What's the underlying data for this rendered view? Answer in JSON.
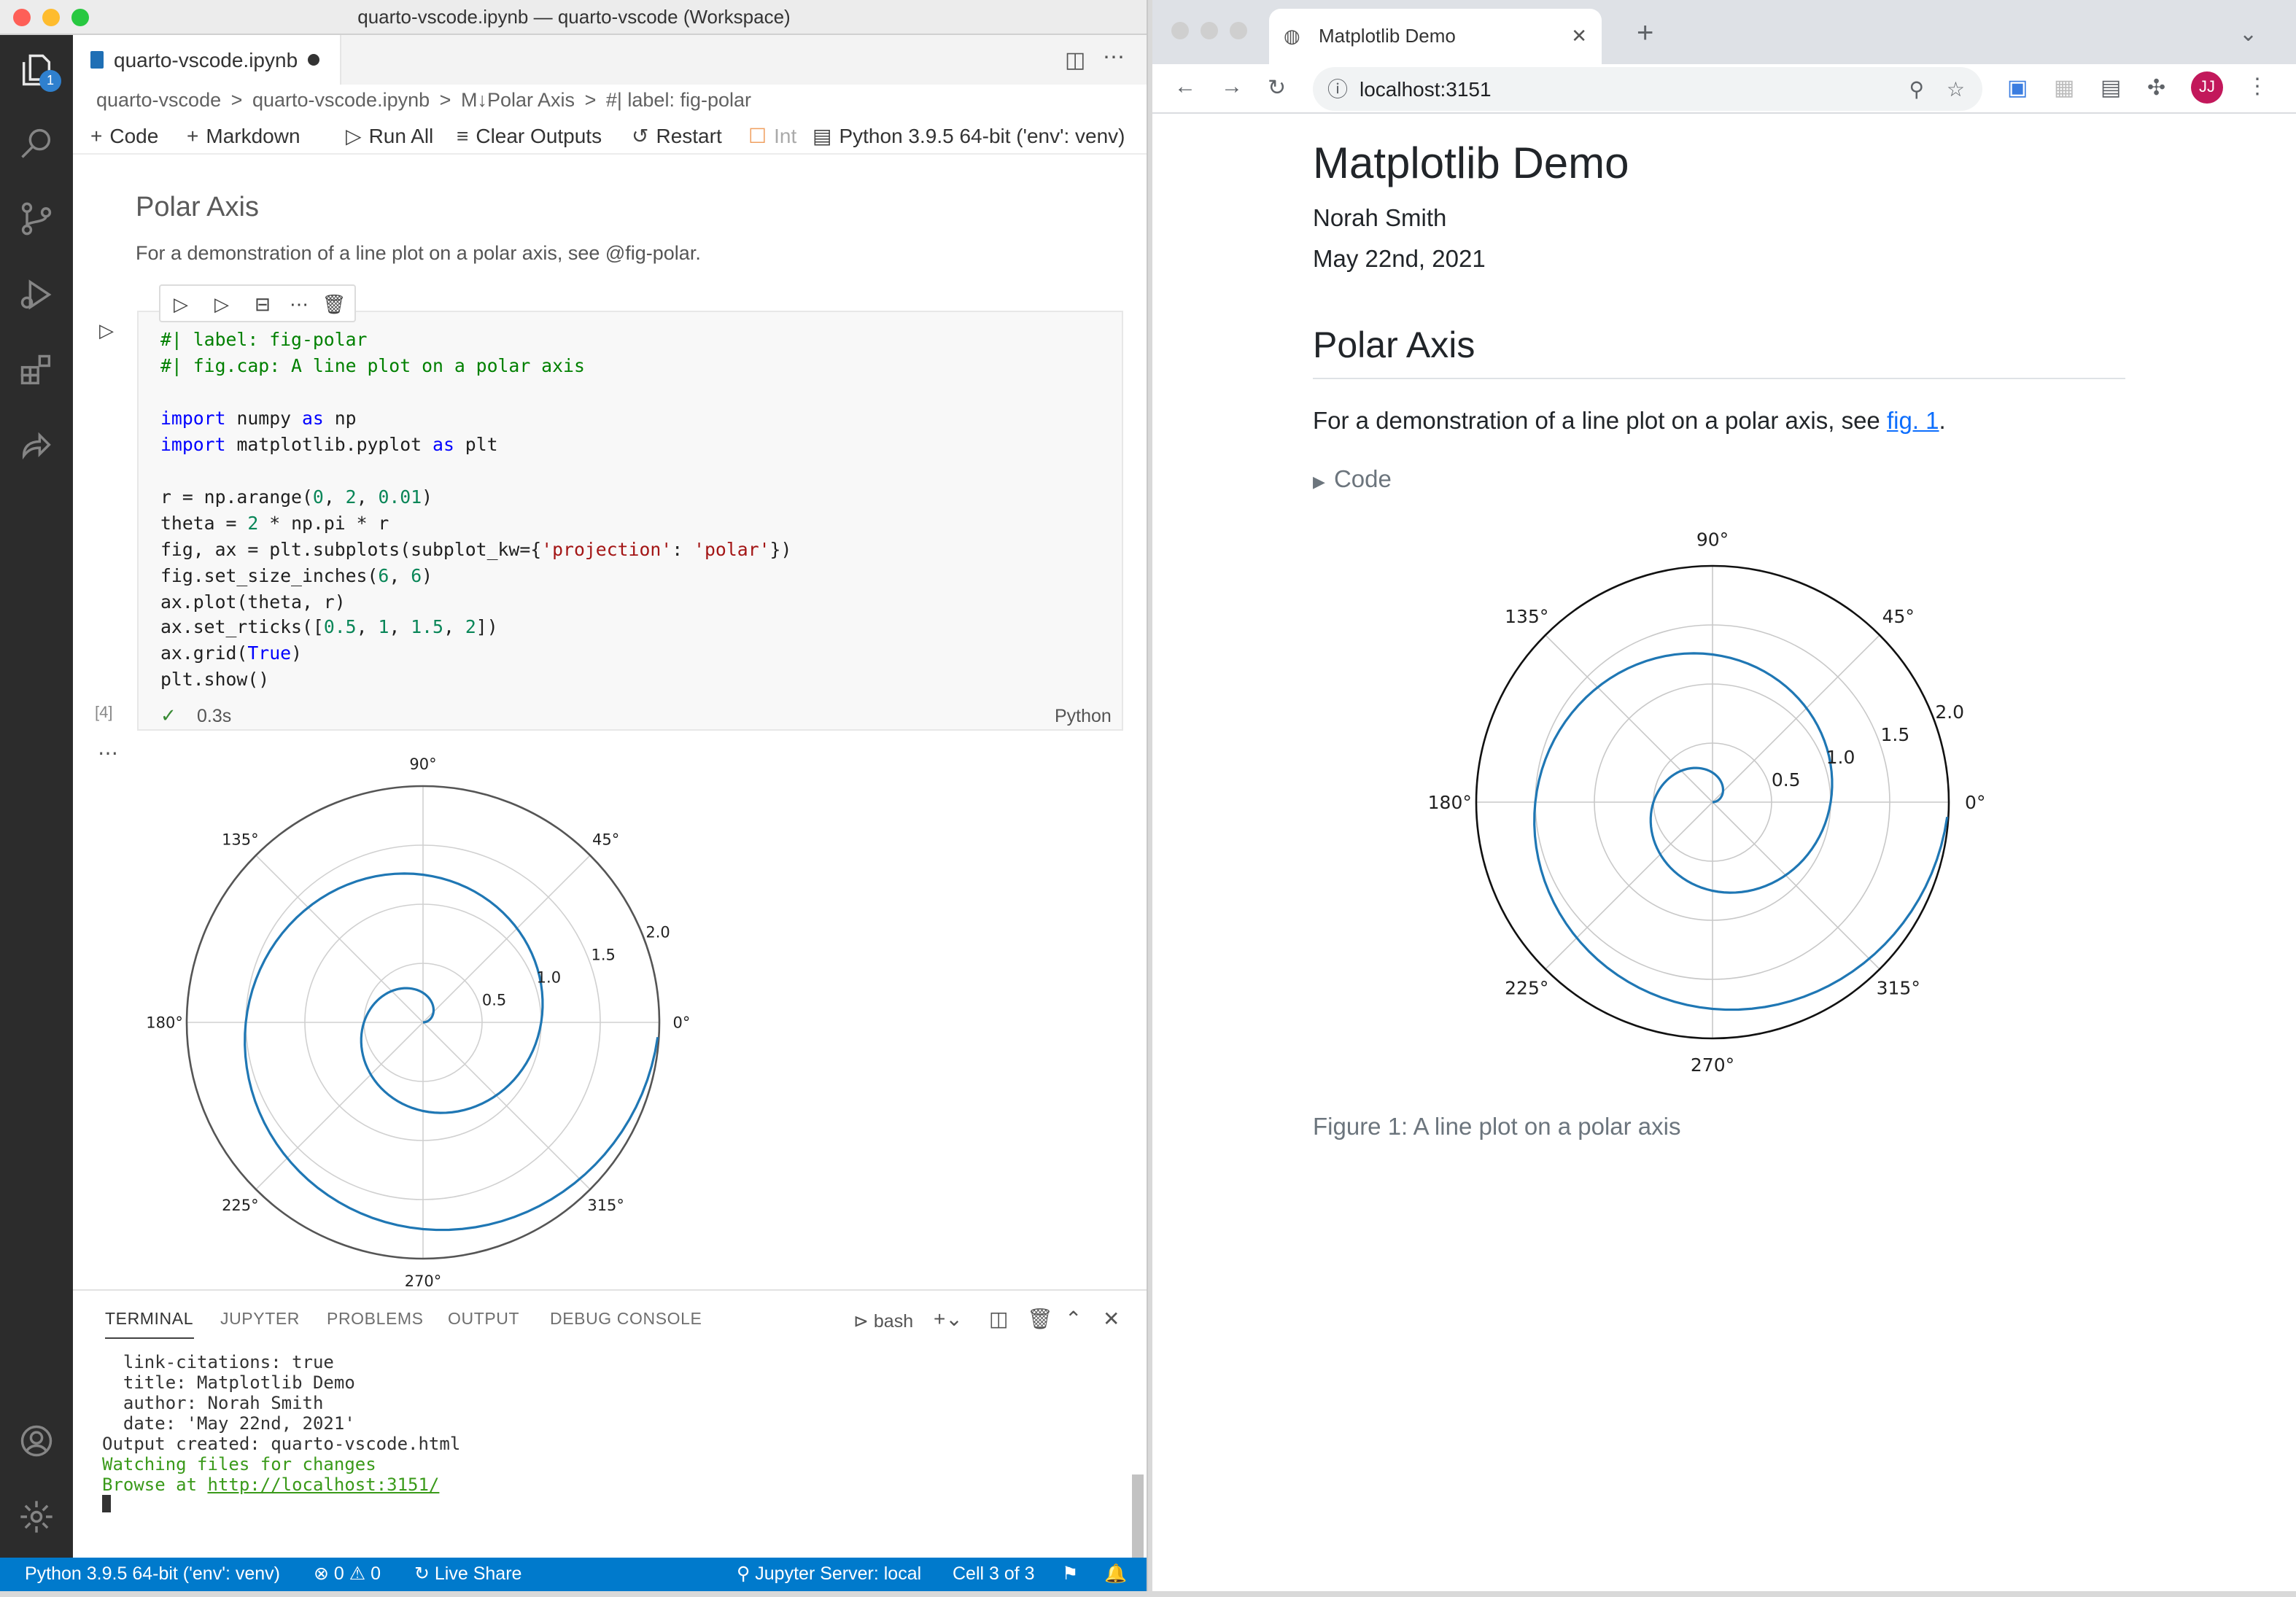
{
  "vscode": {
    "window_title": "quarto-vscode.ipynb — quarto-vscode (Workspace)",
    "explorer_badge": "1",
    "tab_label": "quarto-vscode.ipynb",
    "breadcrumb": [
      "quarto-vscode",
      ">",
      "quarto-vscode.ipynb",
      ">",
      "M↓Polar Axis",
      ">",
      "#| label: fig-polar"
    ],
    "toolbar": {
      "code": "Code",
      "markdown": "Markdown",
      "run_all": "Run All",
      "clear_outputs": "Clear Outputs",
      "restart": "Restart",
      "interrupt": "Int",
      "kernel": "Python 3.9.5 64-bit ('env': venv)"
    },
    "markdown_cell": {
      "heading": "Polar Axis",
      "text": "For a demonstration of a line plot on a polar axis, see @fig-polar."
    },
    "code_cell": {
      "exec_count": "[4]",
      "exec_time": "0.3s",
      "language": "Python"
    },
    "panel": {
      "tabs": [
        "TERMINAL",
        "JUPYTER",
        "PROBLEMS",
        "OUTPUT",
        "DEBUG CONSOLE"
      ],
      "shell": "bash",
      "terminal_lines": [
        "  link-citations: true",
        "  title: Matplotlib Demo",
        "  author: Norah Smith",
        "  date: 'May 22nd, 2021'",
        "",
        "Output created: quarto-vscode.html",
        ""
      ],
      "watching": "Watching files for changes",
      "browse_prefix": "Browse at ",
      "browse_url": "http://localhost:3151/"
    },
    "status": {
      "interpreter": "Python 3.9.5 64-bit ('env': venv)",
      "problems": "⊗ 0  ⚠ 0",
      "live_share": "Live Share",
      "jupyter": "Jupyter Server: local",
      "cell": "Cell 3 of 3"
    }
  },
  "browser": {
    "tab_title": "Matplotlib Demo",
    "url": "localhost:3151",
    "avatar": "JJ",
    "page": {
      "title": "Matplotlib Demo",
      "author": "Norah Smith",
      "date": "May 22nd, 2021",
      "section": "Polar Axis",
      "para_prefix": "For a demonstration of a line plot on a polar axis, see ",
      "para_link": "fig. 1",
      "para_suffix": ".",
      "code_toggle": "Code",
      "caption": "Figure 1: A line plot on a polar axis"
    }
  },
  "chart_data": {
    "type": "line",
    "projection": "polar",
    "r": {
      "start": 0,
      "stop": 2,
      "step": 0.01
    },
    "theta": "2 * pi * r",
    "rticks": [
      0.5,
      1,
      1.5,
      2
    ],
    "rtick_labels": [
      "0.5",
      "1.0",
      "1.5",
      "2.0"
    ],
    "angle_labels": [
      "0°",
      "45°",
      "90°",
      "135°",
      "180°",
      "225°",
      "270°",
      "315°"
    ],
    "grid": true,
    "line_color": "#1f77b4"
  }
}
